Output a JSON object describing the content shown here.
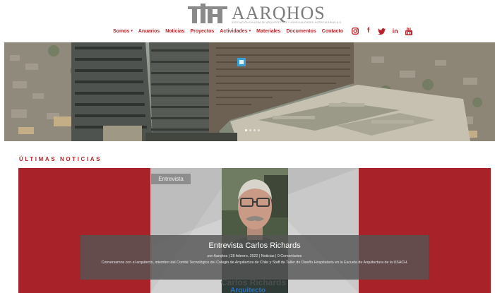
{
  "brand": {
    "name": "AARQHOS",
    "tagline": "ASOCIACIÓN CHILENA DE ARQUITECTURA Y ESPECIALIDADES HOSPITALARIAS A.G."
  },
  "nav": {
    "items": [
      {
        "label": "Somos",
        "has_dropdown": true
      },
      {
        "label": "Anuarios",
        "has_dropdown": false
      },
      {
        "label": "Noticias",
        "has_dropdown": false
      },
      {
        "label": "Proyectos",
        "has_dropdown": false
      },
      {
        "label": "Actividades",
        "has_dropdown": true
      },
      {
        "label": "Materiales",
        "has_dropdown": false
      },
      {
        "label": "Documentos",
        "has_dropdown": false
      },
      {
        "label": "Contacto",
        "has_dropdown": false
      }
    ],
    "dropdown_caret": "▾",
    "social": [
      {
        "name": "instagram-icon"
      },
      {
        "name": "facebook-icon",
        "glyph": "f"
      },
      {
        "name": "twitter-icon"
      },
      {
        "name": "linkedin-icon",
        "glyph": "in"
      },
      {
        "name": "youtube-icon"
      }
    ]
  },
  "hero": {
    "slide_count": 4,
    "active_slide": 0
  },
  "news": {
    "section_title": "ÚLTIMAS NOTICIAS",
    "post": {
      "category_badge": "Entrevista",
      "title": "Entrevista Carlos Richards",
      "meta": "por Aarqhos | 28 febrero, 2022 | Noticias | 0 Comentarios",
      "excerpt": "Conversamos con el arquitecto, miembro del Comité Tecnológico del Colegio de Arquitectos de Chile y Staff de Taller de Diseño Hospitalario en la Escuela de Arquitectura de la USACH.",
      "image_name": "Carlos Richards",
      "image_role": "Arquitecto"
    }
  },
  "colors": {
    "accent": "#b8232a",
    "card_red": "#a8222a",
    "overlay": "#555555",
    "role_blue": "#2f6fb0"
  }
}
